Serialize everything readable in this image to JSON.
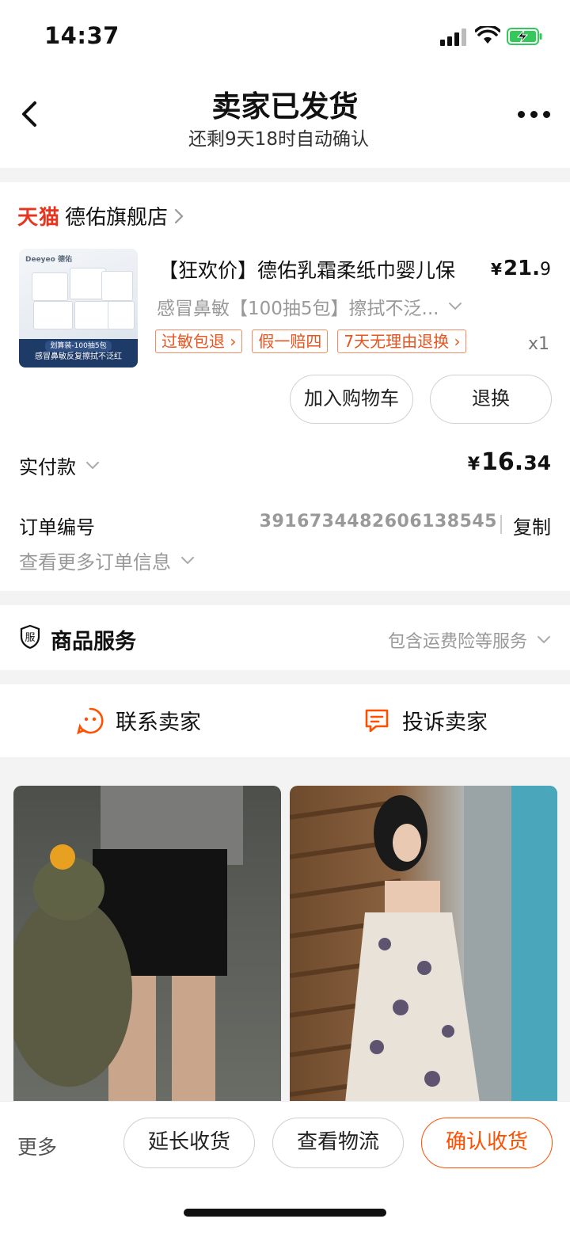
{
  "status_bar": {
    "time": "14:37"
  },
  "nav": {
    "title": "卖家已发货",
    "subtitle": "还剩9天18时自动确认"
  },
  "store": {
    "platform": "天猫",
    "name": "德佑旗舰店"
  },
  "product": {
    "image_brand": "Deeyeo 德佑",
    "image_banner_top": "划算装-100抽5包",
    "image_banner_bottom": "感冒鼻敏反复擦拭不泛红",
    "title": "【狂欢价】德佑乳霜柔纸巾婴儿保",
    "price_symbol": "¥",
    "price_int": "21.",
    "price_dec": "9",
    "spec": "感冒鼻敏【100抽5包】擦拭不泛...",
    "tags": [
      "过敏包退 ›",
      "假一赔四",
      "7天无理由退换 ›"
    ],
    "quantity": "x1",
    "add_to_cart": "加入购物车",
    "return_exchange": "退换"
  },
  "payment": {
    "label": "实付款",
    "symbol": "¥",
    "int": "16.",
    "dec": "34"
  },
  "order": {
    "number_label": "订单编号",
    "number": "3916734482606138545",
    "copy": "复制",
    "more_info": "查看更多订单信息"
  },
  "service": {
    "icon_char": "服",
    "title": "商品服务",
    "desc": "包含运费险等服务"
  },
  "contact": {
    "seller": "联系卖家",
    "complain": "投诉卖家"
  },
  "bottom_bar": {
    "more": "更多",
    "extend": "延长收货",
    "logistics": "查看物流",
    "confirm": "确认收货"
  },
  "colors": {
    "accent": "#ff5000",
    "tmall_red": "#e8331e",
    "tag_orange": "#e8531e",
    "battery_green": "#34c759"
  }
}
